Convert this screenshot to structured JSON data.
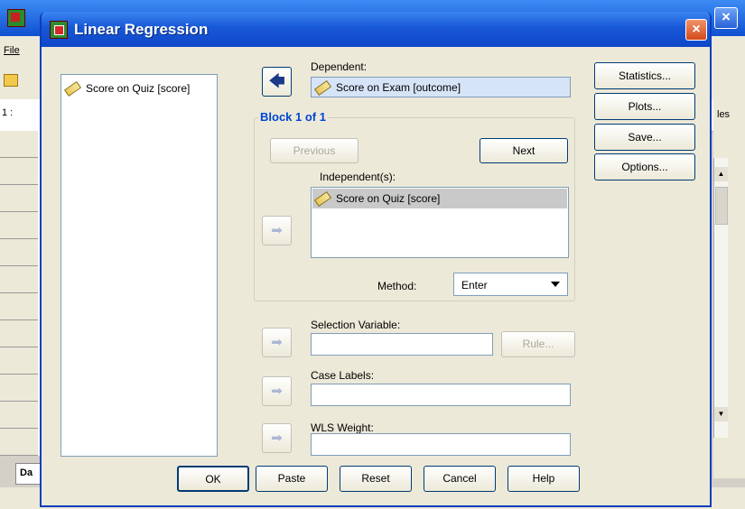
{
  "background": {
    "menu_file": "File",
    "cell_ref": "1 :",
    "vars_tab": "les",
    "data_tab": "Da"
  },
  "dialog": {
    "title": "Linear Regression",
    "close_glyph": "×",
    "source_variables": [
      "Score on Quiz [score]"
    ],
    "dependent": {
      "label": "Dependent:",
      "value": "Score on Exam [outcome]"
    },
    "block": {
      "title": "Block 1 of 1",
      "previous": "Previous",
      "next": "Next",
      "independents_label": "Independent(s):",
      "independents": [
        "Score on Quiz [score]"
      ],
      "method_label": "Method:",
      "method_value": "Enter"
    },
    "selection_variable": {
      "label": "Selection Variable:",
      "value": "",
      "rule_button": "Rule..."
    },
    "case_labels": {
      "label": "Case Labels:",
      "value": ""
    },
    "wls_weight": {
      "label": "WLS Weight:",
      "value": ""
    },
    "side_buttons": {
      "statistics": "Statistics...",
      "plots": "Plots...",
      "save": "Save...",
      "options": "Options..."
    },
    "footer_buttons": {
      "ok": "OK",
      "paste": "Paste",
      "reset": "Reset",
      "cancel": "Cancel",
      "help": "Help"
    }
  }
}
